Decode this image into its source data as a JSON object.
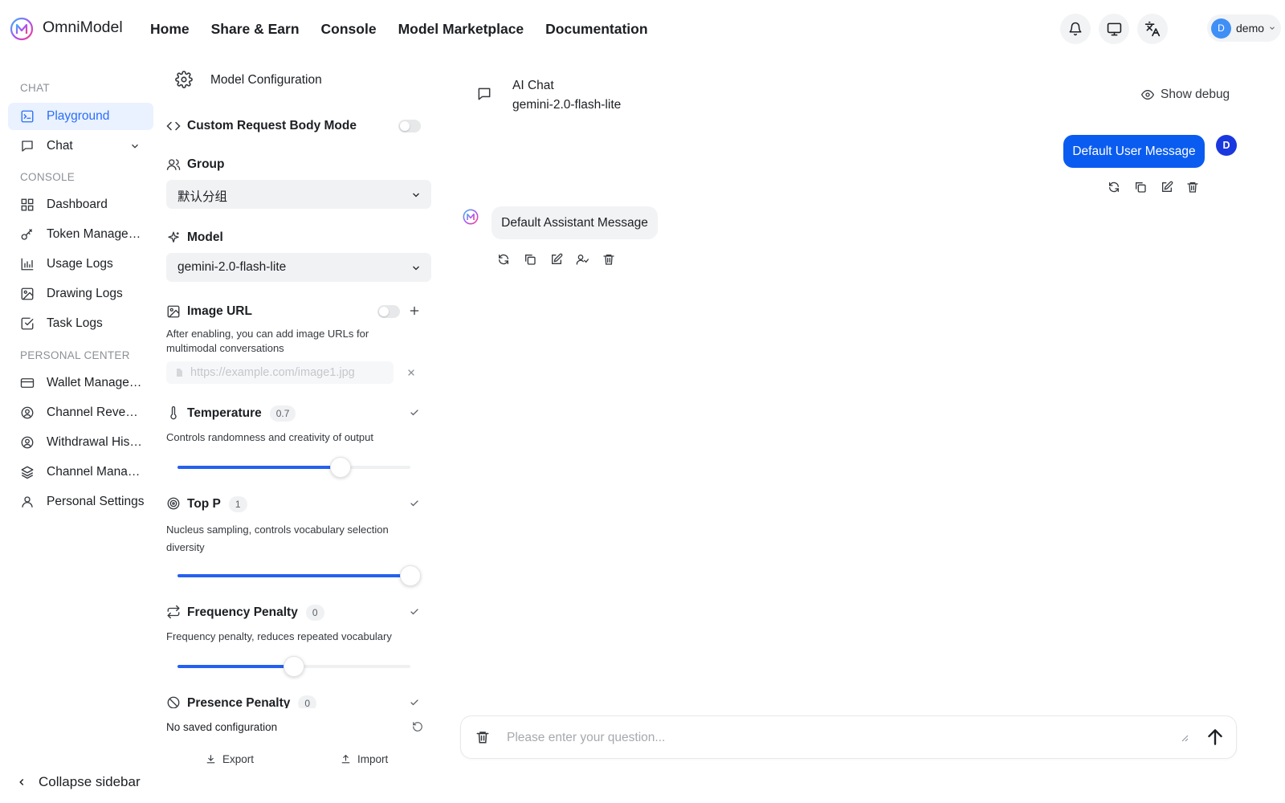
{
  "brand": {
    "name": "OmniModel"
  },
  "nav": [
    "Home",
    "Share & Earn",
    "Console",
    "Model Marketplace",
    "Documentation"
  ],
  "topbar": {
    "icons": [
      "bell-icon",
      "monitor-icon",
      "translate-icon"
    ],
    "user": {
      "initial": "D",
      "name": "demo"
    }
  },
  "sidebar": {
    "sections": [
      {
        "label": "CHAT",
        "items": [
          {
            "label": "Playground",
            "icon": "playground-icon",
            "active": true
          },
          {
            "label": "Chat",
            "icon": "chat-icon",
            "expandable": true
          }
        ]
      },
      {
        "label": "CONSOLE",
        "items": [
          {
            "label": "Dashboard",
            "icon": "dashboard-icon"
          },
          {
            "label": "Token Management",
            "icon": "key-icon"
          },
          {
            "label": "Usage Logs",
            "icon": "bar-chart-icon"
          },
          {
            "label": "Drawing Logs",
            "icon": "image-icon"
          },
          {
            "label": "Task Logs",
            "icon": "check-square-icon"
          }
        ]
      },
      {
        "label": "PERSONAL CENTER",
        "items": [
          {
            "label": "Wallet Management",
            "icon": "wallet-icon"
          },
          {
            "label": "Channel Revenue",
            "icon": "user-circle-icon"
          },
          {
            "label": "Withdrawal History",
            "icon": "user-circle-icon"
          },
          {
            "label": "Channel Management",
            "icon": "layers-icon"
          },
          {
            "label": "Personal Settings",
            "icon": "user-icon"
          }
        ]
      }
    ],
    "collapse_label": "Collapse sidebar"
  },
  "config": {
    "title": "Model Configuration",
    "custom_body": {
      "label": "Custom Request Body Mode",
      "enabled": false
    },
    "group": {
      "label": "Group",
      "value": "默认分组"
    },
    "model": {
      "label": "Model",
      "value": "gemini-2.0-flash-lite"
    },
    "image_url": {
      "label": "Image URL",
      "enabled": false,
      "description": "After enabling, you can add image URLs for multimodal conversations",
      "placeholder": "https://example.com/image1.jpg"
    },
    "temperature": {
      "label": "Temperature",
      "value": "0.7",
      "description": "Controls randomness and creativity of output",
      "slider_fraction": 0.7
    },
    "top_p": {
      "label": "Top P",
      "value": "1",
      "description": "Nucleus sampling, controls vocabulary selection diversity",
      "slider_fraction": 1.0
    },
    "frequency_penalty": {
      "label": "Frequency Penalty",
      "value": "0",
      "description": "Frequency penalty, reduces repeated vocabulary",
      "slider_fraction": 0.5
    },
    "presence_penalty": {
      "label": "Presence Penalty",
      "value": "0"
    },
    "saved_status": "No saved configuration",
    "export_label": "Export",
    "import_label": "Import"
  },
  "chat": {
    "title": "AI Chat",
    "model": "gemini-2.0-flash-lite",
    "debug_label": "Show debug",
    "user_message": "Default User Message",
    "user_initial": "D",
    "assistant_message": "Default Assistant Message",
    "input_placeholder": "Please enter your question..."
  },
  "colors": {
    "accent": "#0a5cf0",
    "slider": "#2561f0",
    "active_bg": "#eaf1ff",
    "active_text": "#2a6ef5"
  }
}
